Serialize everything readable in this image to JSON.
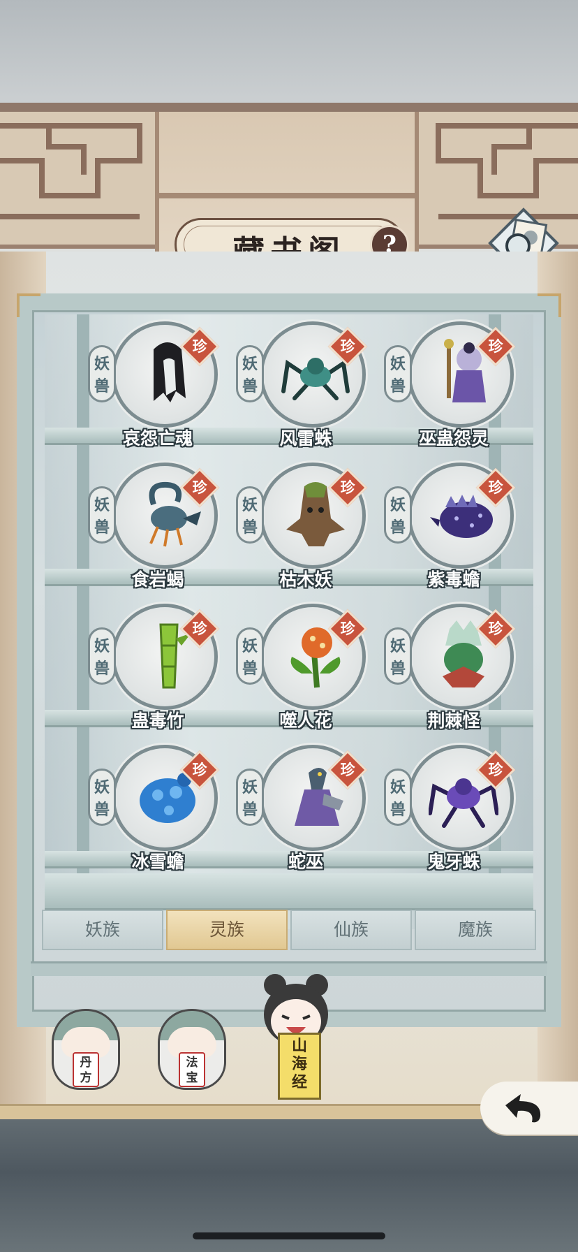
{
  "title": "藏书阁",
  "help_label": "?",
  "tag_chars": [
    "妖",
    "兽"
  ],
  "rare_label": "珍",
  "creatures": [
    {
      "name": "哀怨亡魂"
    },
    {
      "name": "风雷蛛"
    },
    {
      "name": "巫蛊怨灵"
    },
    {
      "name": "食岩蝎"
    },
    {
      "name": "枯木妖"
    },
    {
      "name": "紫毒蟾"
    },
    {
      "name": "蛊毒竹"
    },
    {
      "name": "噬人花"
    },
    {
      "name": "荆棘怪"
    },
    {
      "name": "冰雪蟾"
    },
    {
      "name": "蛇巫"
    },
    {
      "name": "鬼牙蛛"
    }
  ],
  "tabs": [
    {
      "label": "妖族",
      "active": false
    },
    {
      "label": "灵族",
      "active": true
    },
    {
      "label": "仙族",
      "active": false
    },
    {
      "label": "魔族",
      "active": false
    }
  ],
  "bottom_nav": {
    "danfang_line1": "丹",
    "danfang_line2": "方",
    "fabao_line1": "法",
    "fabao_line2": "宝",
    "shanhaijing": "山海经",
    "shanhaijing_line1": "山",
    "shanhaijing_line2": "海",
    "shanhaijing_line3": "经"
  },
  "icons": {
    "help": "question-icon",
    "map": "scroll-map-search-icon",
    "back": "return-arrow-icon",
    "up": "chevron-up-icon"
  },
  "colors": {
    "rare_badge": "#c8543d",
    "active_tab": "#e1c892",
    "frame": "#b8c9c8"
  }
}
